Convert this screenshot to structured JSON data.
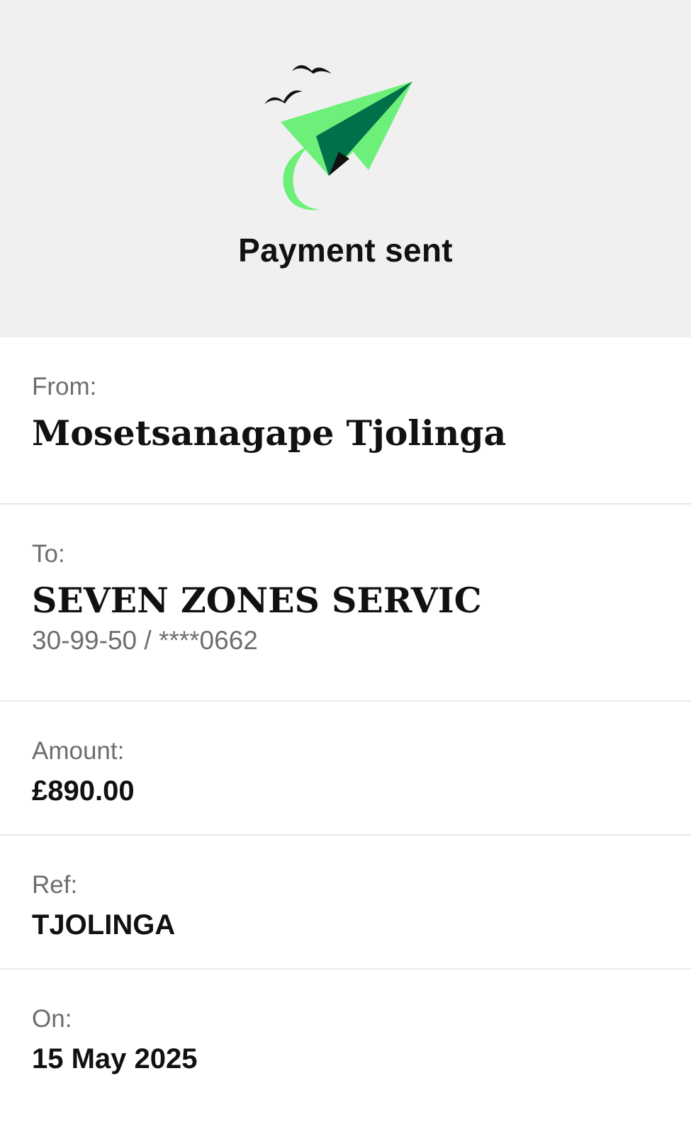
{
  "header": {
    "title": "Payment sent",
    "illustration": "paper-plane-icon"
  },
  "from": {
    "label": "From:",
    "name": "Mosetsanagape Tjolinga"
  },
  "to": {
    "label": "To:",
    "name": "SEVEN ZONES SERVIC",
    "account": "30-99-50 / ****0662"
  },
  "amount": {
    "label": "Amount:",
    "value": "£890.00"
  },
  "ref": {
    "label": "Ref:",
    "value": "TJOLINGA"
  },
  "on": {
    "label": "On:",
    "value": "15 May 2025"
  },
  "colors": {
    "plane_light": "#6cf07a",
    "plane_dark": "#00704a",
    "header_bg": "#f0f0f0",
    "divider": "#e8e8e8",
    "label_gray": "#6e6e6e"
  }
}
